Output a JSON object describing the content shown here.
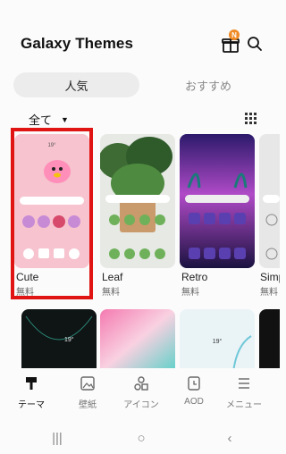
{
  "header": {
    "title": "Galaxy Themes",
    "badge": "N"
  },
  "tabs": [
    {
      "label": "人気",
      "active": true
    },
    {
      "label": "おすすめ",
      "active": false
    }
  ],
  "filter": {
    "label": "全て"
  },
  "themes": [
    {
      "name": "Cute",
      "price": "無料",
      "selected": true
    },
    {
      "name": "Leaf",
      "price": "無料"
    },
    {
      "name": "Retro",
      "price": "無料"
    },
    {
      "name": "Simp",
      "price": "無料"
    }
  ],
  "preview_text": {
    "clock": "19°"
  },
  "bottom_nav": [
    {
      "label": "テーマ",
      "icon": "brush-icon",
      "active": true
    },
    {
      "label": "壁紙",
      "icon": "image-icon"
    },
    {
      "label": "アイコン",
      "icon": "apps-icon"
    },
    {
      "label": "AOD",
      "icon": "clock-icon"
    },
    {
      "label": "メニュー",
      "icon": "menu-icon"
    }
  ],
  "colors": {
    "highlight": "#e11414",
    "badge": "#f08a24"
  }
}
